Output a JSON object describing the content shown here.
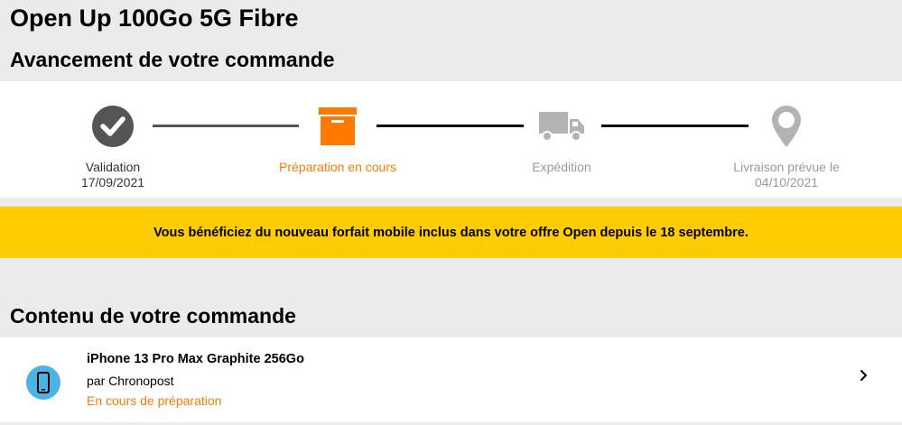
{
  "page": {
    "title": "Open Up 100Go 5G Fibre"
  },
  "progress": {
    "heading": "Avancement de votre commande",
    "steps": [
      {
        "label": "Validation",
        "date": "17/09/2021",
        "state": "done",
        "icon": "check-circle-icon"
      },
      {
        "label": "Préparation en cours",
        "date": "",
        "state": "active",
        "icon": "box-icon"
      },
      {
        "label": "Expédition",
        "date": "",
        "state": "pending",
        "icon": "truck-icon"
      },
      {
        "label": "Livraison prévue le",
        "date": "04/10/2021",
        "state": "pending",
        "icon": "location-pin-icon"
      }
    ]
  },
  "banner": {
    "text": "Vous bénéficiez du nouveau forfait mobile inclus dans votre offre Open depuis le 18 septembre."
  },
  "contents": {
    "heading": "Contenu de votre commande",
    "items": [
      {
        "name": "iPhone 13 Pro Max Graphite 256Go",
        "carrier": "par Chronopost",
        "status": "En cours de préparation",
        "icon": "smartphone-icon"
      }
    ]
  },
  "colors": {
    "accent": "#ff7900",
    "banner": "#ffcc00",
    "done": "#555555",
    "pending": "#b3b3b3",
    "phone_icon_bg": "#4bb4e6"
  }
}
